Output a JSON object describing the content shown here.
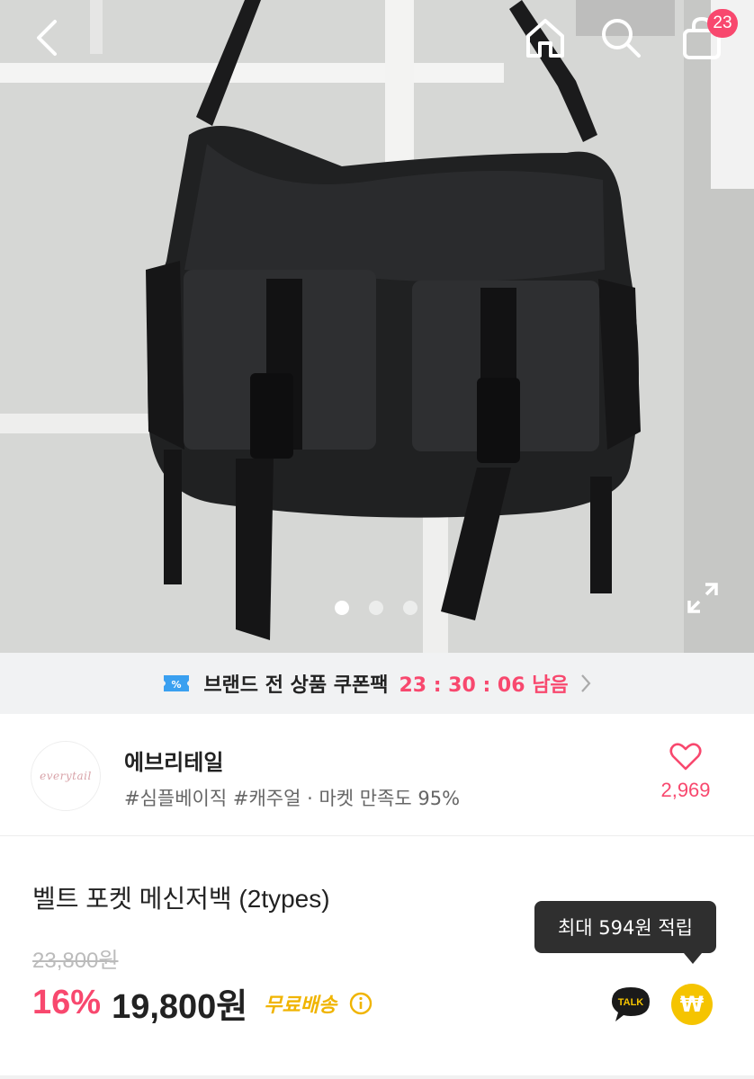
{
  "header": {
    "cart_count": "23",
    "icons": [
      "back-icon",
      "home-icon",
      "search-icon",
      "shopping-bag-icon"
    ]
  },
  "gallery": {
    "total_images": 3,
    "active_index": 0,
    "expand_icon": "expand-icon"
  },
  "coupon": {
    "label": "브랜드 전 상품 쿠폰팩",
    "timer": "23 : 30 : 06 남음",
    "icon": "coupon-ticket-icon"
  },
  "store": {
    "logo_text": "everytail",
    "name": "에브리테일",
    "tags": "#심플베이직 #캐주얼 · 마켓 만족도 95%",
    "like_count": "2,969"
  },
  "product": {
    "title": "벨트 포켓 메신저백 (2types)",
    "original_price": "23,800원",
    "discount": "16%",
    "sale_price": "19,800원",
    "shipping": "무료배송",
    "points_tooltip": "최대 594원 적립",
    "talk_label": "TALK",
    "point_symbol": "₩"
  },
  "colors": {
    "accent": "#f8486e",
    "shipping": "#f0b400",
    "point": "#f5c400",
    "banner_bg": "#f1f2f3"
  }
}
